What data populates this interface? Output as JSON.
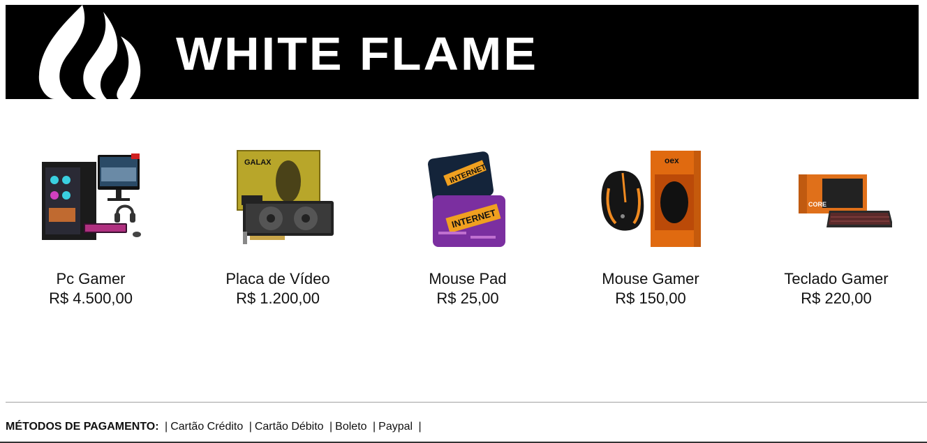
{
  "header": {
    "brand": "WHITE FLAME",
    "logo_icon": "flame-icon"
  },
  "products": [
    {
      "name": "Pc Gamer",
      "price": "R$ 4.500,00",
      "icon": "gaming-pc-image"
    },
    {
      "name": "Placa de Vídeo",
      "price": "R$ 1.200,00",
      "icon": "graphics-card-image",
      "image_text": "GALAX"
    },
    {
      "name": "Mouse Pad",
      "price": "R$ 25,00",
      "icon": "mouse-pad-image",
      "image_text": "INTERNET"
    },
    {
      "name": "Mouse Gamer",
      "price": "R$ 150,00",
      "icon": "gaming-mouse-image",
      "image_text": "oex"
    },
    {
      "name": "Teclado Gamer",
      "price": "R$ 220,00",
      "icon": "gaming-keyboard-image",
      "image_text": "CORE"
    }
  ],
  "footer": {
    "label": "MÉTODOS DE PAGAMENTO:",
    "separator": "|",
    "methods": [
      "Cartão Crédito",
      "Cartão Débito",
      "Boleto",
      "Paypal"
    ]
  },
  "colors": {
    "banner_bg": "#000000",
    "brand_text": "#ffffff",
    "accent_orange": "#f07a1a",
    "accent_purple": "#7b2fa0"
  }
}
